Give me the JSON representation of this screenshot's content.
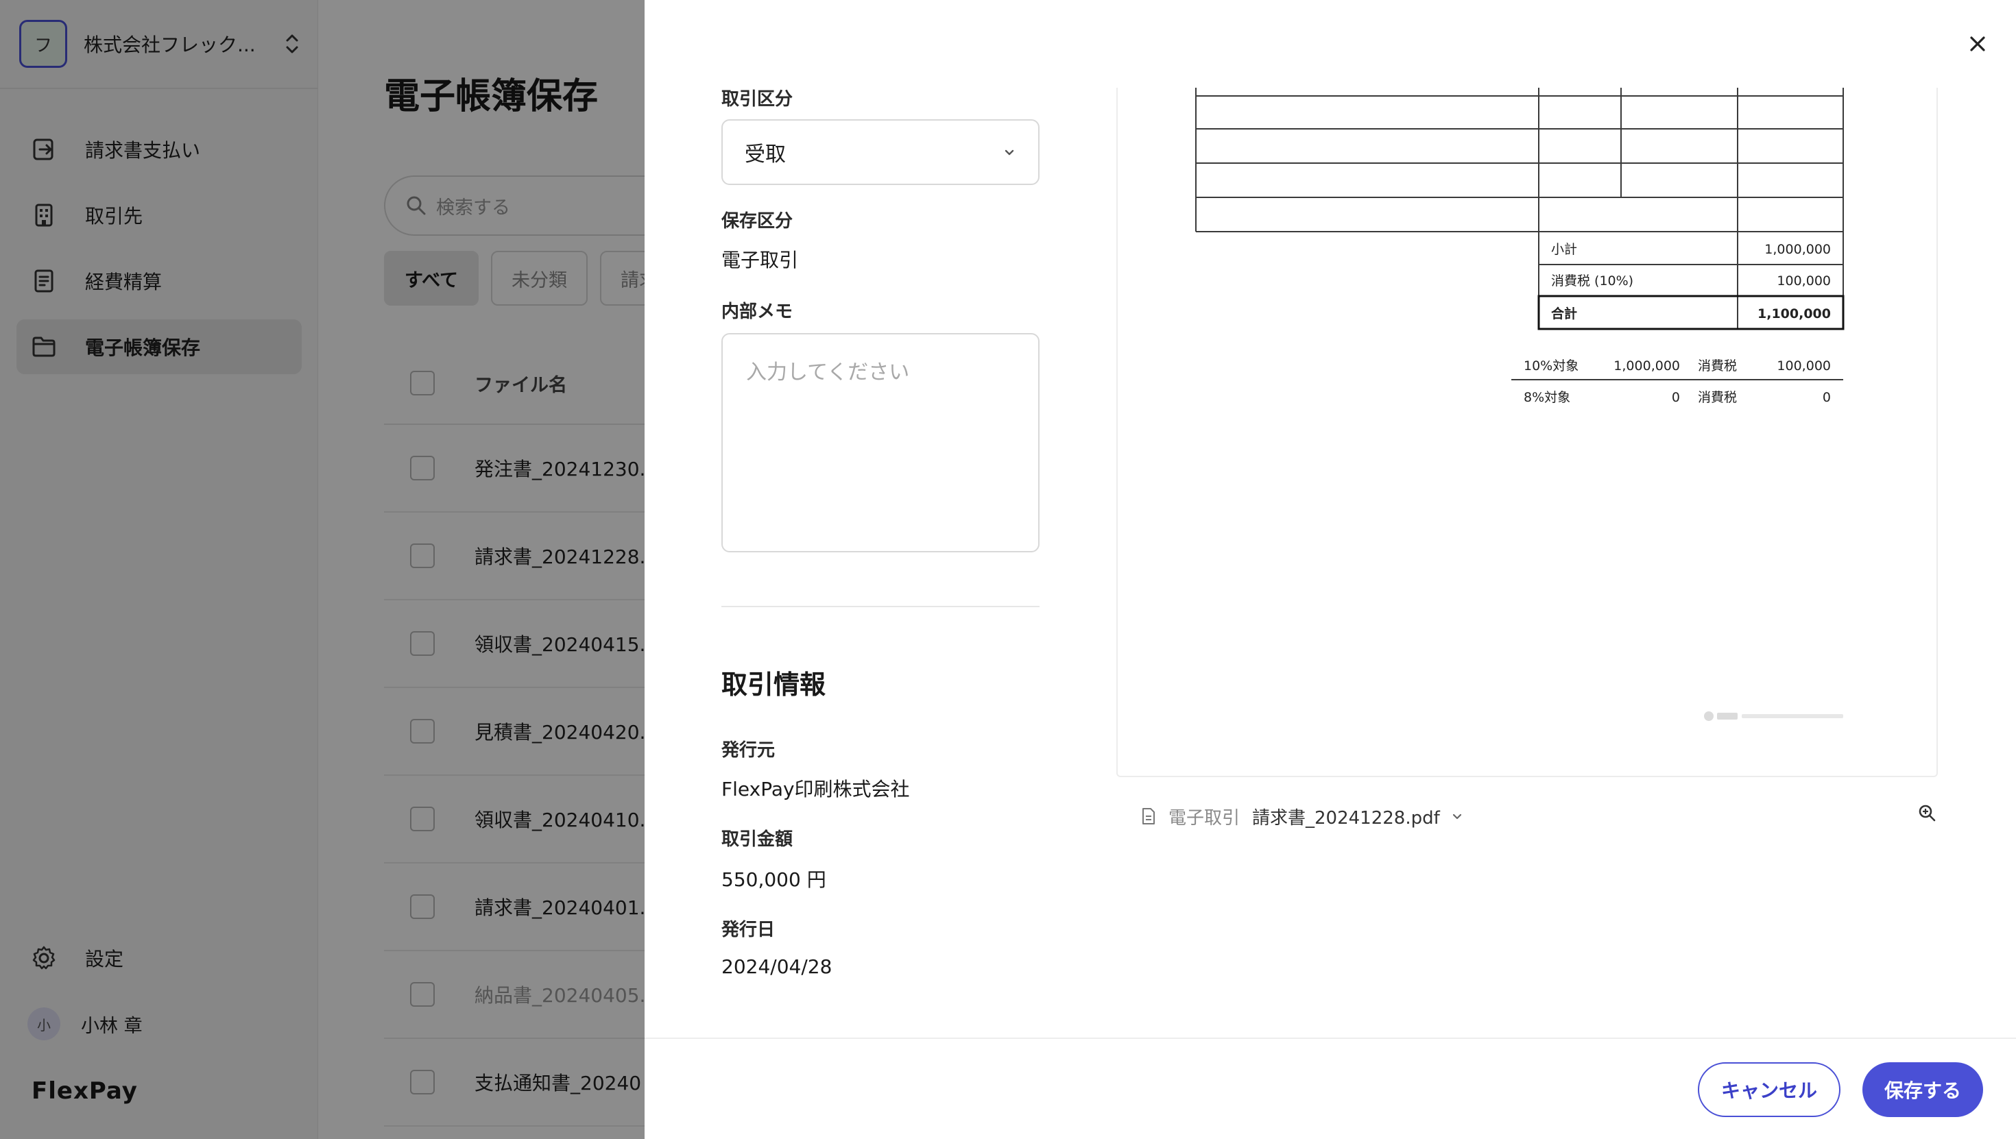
{
  "colors": {
    "accent": "#4a50d6",
    "overlay": "rgba(0,0,0,0.45)"
  },
  "sidebar": {
    "org_initial": "フ",
    "org_name": "株式会社フレック...",
    "items": [
      {
        "label": "請求書支払い",
        "icon": "invoice-payment-icon"
      },
      {
        "label": "取引先",
        "icon": "building-icon"
      },
      {
        "label": "経費精算",
        "icon": "receipt-icon"
      },
      {
        "label": "電子帳簿保存",
        "icon": "folder-icon",
        "active": true
      }
    ],
    "settings_label": "設定",
    "user_initial": "小",
    "user_name": "小林 章",
    "logo": "FlexPay"
  },
  "main": {
    "title": "電子帳簿保存",
    "search_placeholder": "検索する",
    "filters": [
      "すべて",
      "未分類",
      "請求"
    ],
    "column_filename": "ファイル名",
    "rows": [
      {
        "name": "発注書_20241230.p"
      },
      {
        "name": "請求書_20241228.p"
      },
      {
        "name": "領収書_20240415.p"
      },
      {
        "name": "見積書_20240420."
      },
      {
        "name": "領収書_20240410.p"
      },
      {
        "name": "請求書_20240401.p"
      },
      {
        "name": "納品書_20240405.",
        "muted": true
      },
      {
        "name": "支払通知書_20240"
      }
    ]
  },
  "drawer": {
    "transaction_type_label": "取引区分",
    "transaction_type_value": "受取",
    "storage_type_label": "保存区分",
    "storage_type_value": "電子取引",
    "memo_label": "内部メモ",
    "memo_placeholder": "入力してください",
    "section_title": "取引情報",
    "issuer_label": "発行元",
    "issuer_value": "FlexPay印刷株式会社",
    "amount_label": "取引金額",
    "amount_value": "550,000 円",
    "date_label": "発行日",
    "date_value": "2024/04/28",
    "preview": {
      "subtotal_label": "小計",
      "subtotal": "1,000,000",
      "tax_label": "消費税 (10%)",
      "tax": "100,000",
      "total_label": "合計",
      "total": "1,100,000",
      "r1_label": "10%対象",
      "r1_amount": "1,000,000",
      "r1_tax_label": "消費税",
      "r1_tax": "100,000",
      "r2_label": "8%対象",
      "r2_amount": "0",
      "r2_tax_label": "消費税",
      "r2_tax": "0"
    },
    "file_type": "電子取引",
    "file_name": "請求書_20241228.pdf",
    "cancel_label": "キャンセル",
    "save_label": "保存する"
  }
}
